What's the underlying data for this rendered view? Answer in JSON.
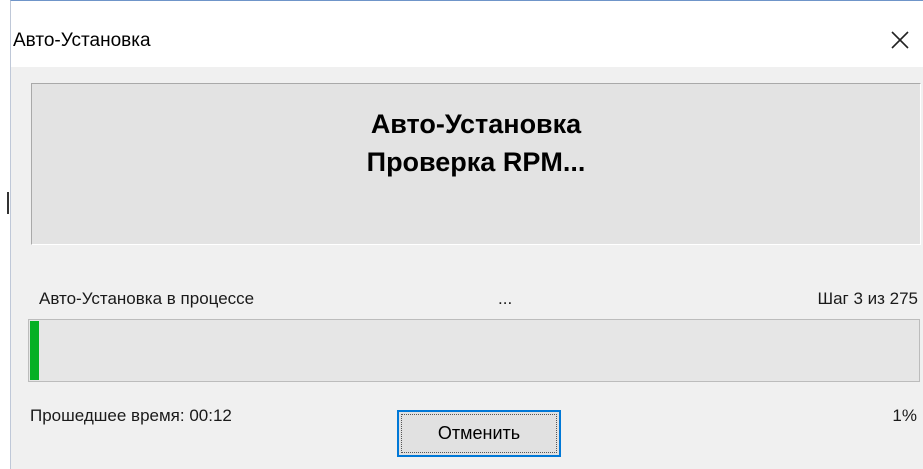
{
  "window": {
    "title": "Авто-Установка",
    "close_icon": "close-icon"
  },
  "banner": {
    "line1": "Авто-Установка",
    "line2": "Проверка RPM..."
  },
  "status": {
    "label": "Авто-Установка в процессе",
    "dots": "...",
    "step": "Шаг 3 из 275"
  },
  "progress": {
    "percent_value": 1,
    "fill_color": "#06b025",
    "elapsed": "Прошедшее время: 00:12",
    "percent_text": "1%"
  },
  "buttons": {
    "cancel_label": "Отменить"
  },
  "colors": {
    "accent": "#0078d7",
    "progress": "#06b025"
  }
}
